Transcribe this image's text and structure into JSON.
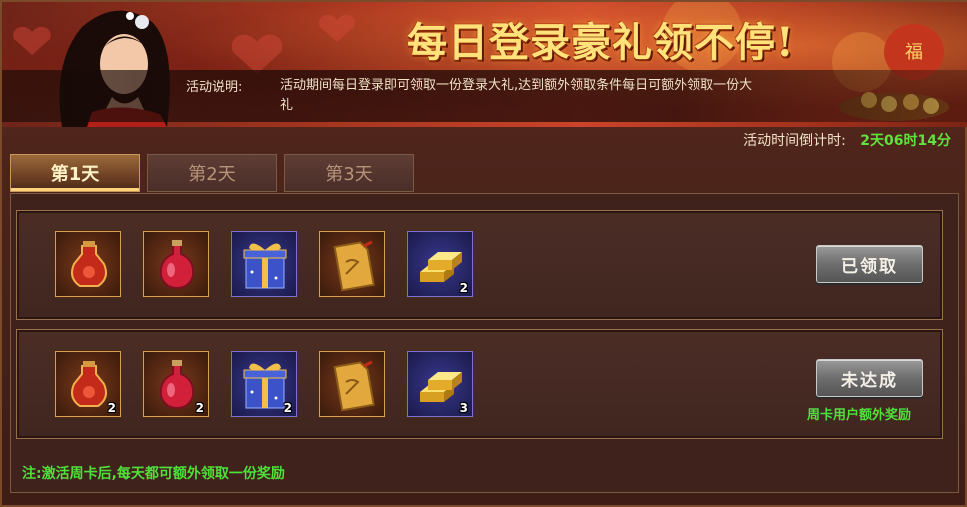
{
  "banner": {
    "title": "每日登录豪礼领不停!",
    "desc_label": "活动说明:",
    "desc_text": "活动期间每日登录即可领取一份登录大礼,达到额外领取条件每日可额外领取一份大礼"
  },
  "countdown": {
    "label": "活动时间倒计时:",
    "value": "2天06时14分"
  },
  "tabs": [
    {
      "label": "第1天",
      "active": true
    },
    {
      "label": "第2天",
      "active": false
    },
    {
      "label": "第3天",
      "active": false
    }
  ],
  "rows": [
    {
      "items": [
        {
          "icon": "red-potion-flask-icon",
          "count": ""
        },
        {
          "icon": "red-potion-bottle-icon",
          "count": ""
        },
        {
          "icon": "gift-box-icon",
          "count": ""
        },
        {
          "icon": "gold-scroll-tag-icon",
          "count": ""
        },
        {
          "icon": "gold-bars-icon",
          "count": "2"
        }
      ],
      "button": "已领取"
    },
    {
      "items": [
        {
          "icon": "red-potion-flask-icon",
          "count": "2"
        },
        {
          "icon": "red-potion-bottle-icon",
          "count": "2"
        },
        {
          "icon": "gift-box-icon",
          "count": "2"
        },
        {
          "icon": "gold-scroll-tag-icon",
          "count": ""
        },
        {
          "icon": "gold-bars-icon",
          "count": "3"
        }
      ],
      "button": "未达成",
      "note": "周卡用户额外奖励"
    }
  ],
  "footer_note": "注:激活周卡后,每天都可额外领取一份奖励",
  "colors": {
    "accent_green": "#4fe03a",
    "title_gold": "#ffe27a"
  }
}
